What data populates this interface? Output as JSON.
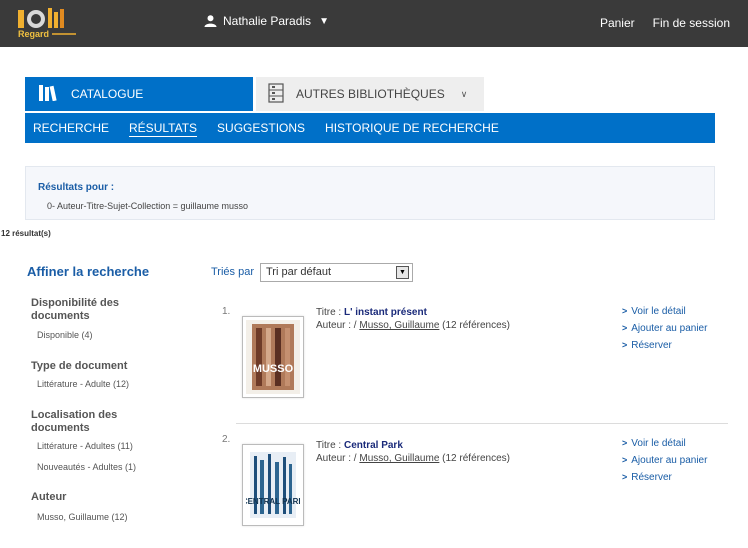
{
  "header": {
    "logo_text": "Regard",
    "user_name": "Nathalie Paradis",
    "panier": "Panier",
    "logout": "Fin de session"
  },
  "tabs": {
    "catalogue": "CATALOGUE",
    "autres": "AUTRES BIBLIOTHÈQUES"
  },
  "subnav": [
    "RECHERCHE",
    "RÉSULTATS",
    "SUGGESTIONS",
    "HISTORIQUE DE RECHERCHE"
  ],
  "results_box": {
    "title": "Résultats pour :",
    "query": "0- Auteur-Titre-Sujet-Collection = guillaume musso"
  },
  "result_count": "12 résultat(s)",
  "facets": {
    "title": "Affiner la recherche",
    "groups": [
      {
        "heading": "Disponibilité des documents",
        "items": [
          "Disponible (4)"
        ]
      },
      {
        "heading": "Type de document",
        "items": [
          "Littérature - Adulte (12)"
        ]
      },
      {
        "heading": "Localisation des documents",
        "items": [
          "Littérature - Adultes (11)",
          "Nouveautés - Adultes (1)"
        ]
      },
      {
        "heading": "Auteur",
        "items": [
          "Musso, Guillaume (12)"
        ]
      }
    ]
  },
  "sort": {
    "label": "Triés par",
    "selected": "Tri par défaut"
  },
  "records": [
    {
      "num": "1.",
      "title_label": "Titre : ",
      "title": "L' instant présent",
      "author_label": "Auteur : / ",
      "author": "Musso, Guillaume",
      "refs": " (12 références)",
      "cover_text": "MUSSO"
    },
    {
      "num": "2.",
      "title_label": "Titre : ",
      "title": "Central Park",
      "author_label": "Auteur : / ",
      "author": "Musso, Guillaume",
      "refs": " (12 références)",
      "cover_text": "CENTRAL PARK"
    }
  ],
  "actions": [
    "Voir le détail",
    "Ajouter au panier",
    "Réserver"
  ],
  "colors": {
    "topbar": "#3a3a3a",
    "accent": "#0070c8",
    "link": "#1a5da6"
  }
}
